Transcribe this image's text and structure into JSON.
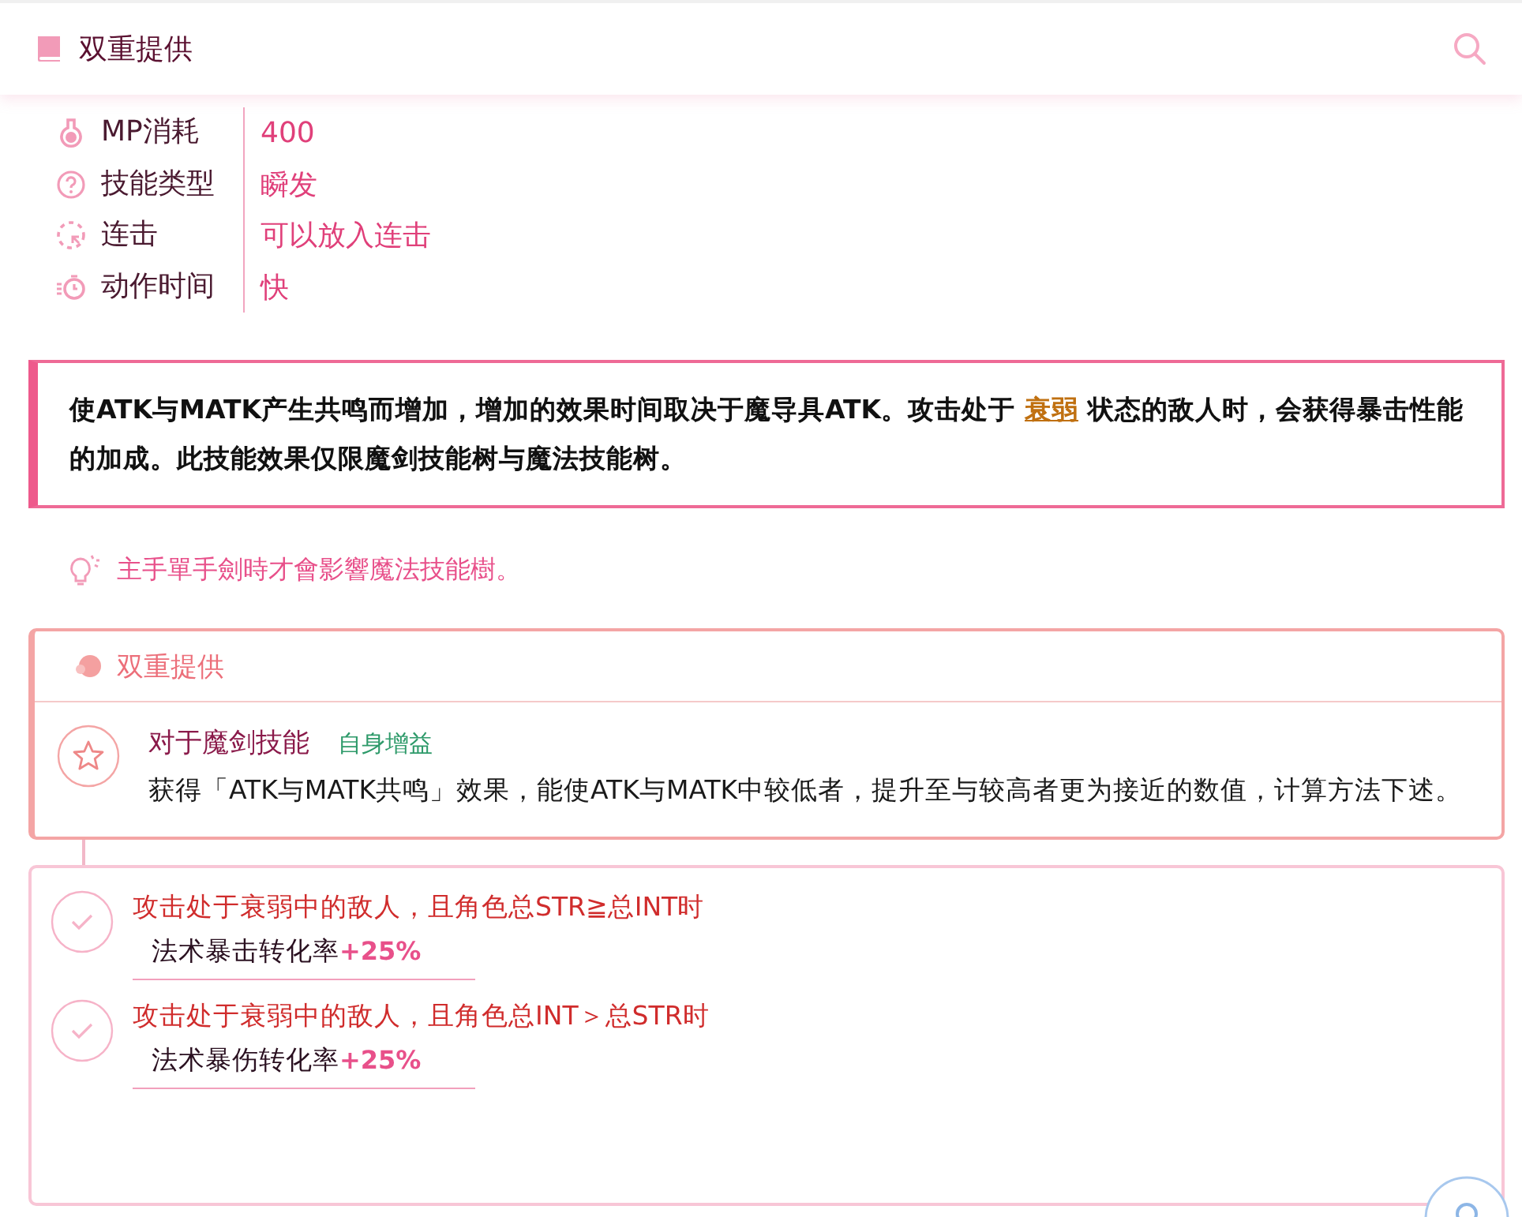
{
  "header": {
    "title": "双重提供"
  },
  "stats": [
    {
      "label": "MP消耗",
      "value": "400"
    },
    {
      "label": "技能类型",
      "value": "瞬发"
    },
    {
      "label": "连击",
      "value": "可以放入连击"
    },
    {
      "label": "动作时间",
      "value": "快"
    }
  ],
  "description": {
    "before": "使ATK与MATK产生共鸣而增加，增加的效果时间取决于魔导具ATK。攻击处于",
    "link": "衰弱",
    "after": "状态的敌人时，会获得暴击性能的加成。此技能效果仅限魔剑技能树与魔法技能树。"
  },
  "tip": "主手單手劍時才會影響魔法技能樹。",
  "effect_card": {
    "title": "双重提供",
    "effects": [
      {
        "target": "对于魔剑技能",
        "tag": "自身增益",
        "text": "获得「ATK与MATK共鸣」效果，能使ATK与MATK中较低者，提升至与较高者更为接近的数值，计算方法下述。"
      }
    ]
  },
  "conditions": [
    {
      "condition": "攻击处于衰弱中的敌人，且角色总STR≧总INT时",
      "stat": "法术暴击转化率",
      "value": "+25%"
    },
    {
      "condition": "攻击处于衰弱中的敌人，且角色总INT＞总STR时",
      "stat": "法术暴伤转化率",
      "value": "+25%"
    }
  ]
}
